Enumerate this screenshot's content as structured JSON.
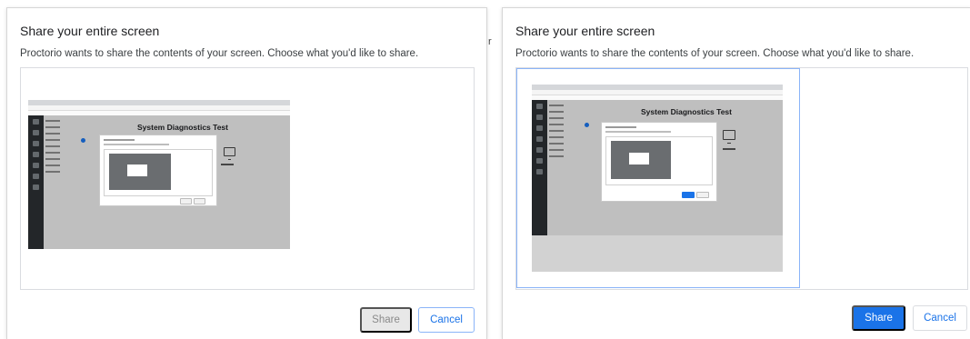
{
  "left_dialog": {
    "title": "Share your entire screen",
    "description": "Proctorio wants to share the contents of your screen. Choose what you'd like to share.",
    "share_label": "Share",
    "cancel_label": "Cancel",
    "thumbnail": {
      "heading": "System Diagnostics Test"
    }
  },
  "right_dialog": {
    "title": "Share your entire screen",
    "description": "Proctorio wants to share the contents of your screen. Choose what you'd like to share.",
    "share_label": "Share",
    "cancel_label": "Cancel",
    "thumbnail": {
      "heading": "System Diagnostics Test"
    }
  },
  "background_text": {
    "peek": "r"
  },
  "colors": {
    "accent": "#1a73e8",
    "selection_border": "#8ab4f8",
    "disabled_button": "#e8e8e8",
    "overlay": "#d2d2d2"
  },
  "icons": [
    "monitor-icon"
  ]
}
